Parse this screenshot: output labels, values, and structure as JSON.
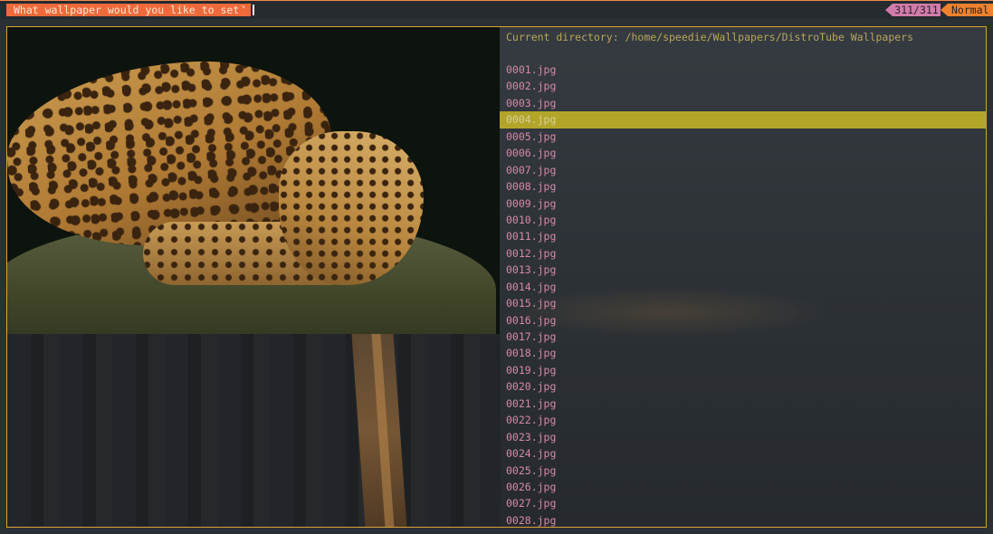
{
  "prompt": {
    "text": "What wallpaper would you like to set?",
    "input_value": ""
  },
  "status": {
    "count": "311/311",
    "mode": "Normal"
  },
  "panel": {
    "current_directory": "Current directory: /home/speedie/Wallpapers/DistroTube Wallpapers"
  },
  "files": [
    "0001.jpg",
    "0002.jpg",
    "0003.jpg",
    "0004.jpg",
    "0005.jpg",
    "0006.jpg",
    "0007.jpg",
    "0008.jpg",
    "0009.jpg",
    "0010.jpg",
    "0011.jpg",
    "0012.jpg",
    "0013.jpg",
    "0014.jpg",
    "0015.jpg",
    "0016.jpg",
    "0017.jpg",
    "0018.jpg",
    "0019.jpg",
    "0020.jpg",
    "0021.jpg",
    "0022.jpg",
    "0023.jpg",
    "0024.jpg",
    "0025.jpg",
    "0026.jpg",
    "0027.jpg",
    "0028.jpg"
  ],
  "selected_file": "0004.jpg",
  "colors": {
    "prompt_bg": "#ef6a3a",
    "count_bg": "#d17bab",
    "mode_bg": "#f0812f",
    "selection_bg": "#b3a52a",
    "item_fg": "#d58aa8",
    "border": "#d8a13a"
  }
}
